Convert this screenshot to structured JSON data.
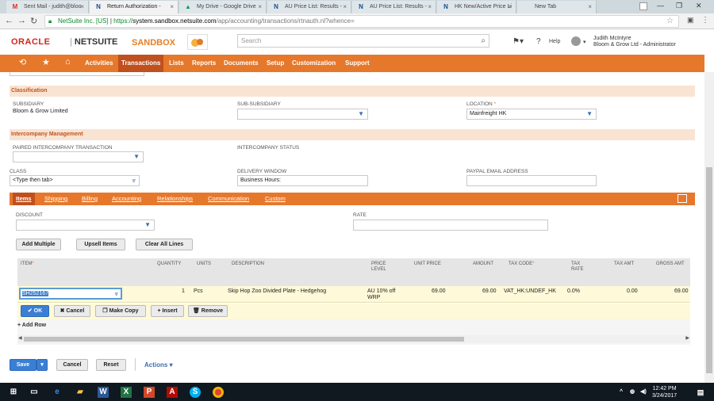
{
  "browser": {
    "tabs": [
      {
        "title": "Sent Mail - judith@bloo",
        "icon": "gmail-icon"
      },
      {
        "title": "Return Authorization -",
        "icon": "netsuite-icon",
        "active": true
      },
      {
        "title": "My Drive - Google Drive",
        "icon": "drive-icon"
      },
      {
        "title": "AU Price List: Results -",
        "icon": "netsuite-icon"
      },
      {
        "title": "AU Price List: Results -",
        "icon": "netsuite-icon"
      },
      {
        "title": "HK New/Active Price Li",
        "icon": "netsuite-icon"
      },
      {
        "title": "New Tab",
        "icon": ""
      }
    ],
    "address": {
      "secure_label": "NetSuite Inc. [US]",
      "protocol": "https://",
      "host": "system.sandbox.netsuite.com",
      "path": "/app/accounting/transactions/rtnauth.nl?whence="
    }
  },
  "header": {
    "brand_oracle": "ORACLE",
    "brand_netsuite": "NETSUITE",
    "sandbox_label": "SANDBOX",
    "search_placeholder": "Search",
    "help_label": "Help",
    "user_name": "Judith McIntyre",
    "user_role": "Bloom & Grow Ltd - Administrator"
  },
  "menu": {
    "items": [
      "Activities",
      "Transactions",
      "Lists",
      "Reports",
      "Documents",
      "Setup",
      "Customization",
      "Support"
    ],
    "active": "Transactions"
  },
  "classification": {
    "header": "Classification",
    "subsidiary_label": "SUBSIDIARY",
    "subsidiary_value": "Bloom & Grow Limited",
    "subsubsidiary_label": "SUB-SUBSIDIARY",
    "location_label": "LOCATION",
    "location_value": "Mainfreight HK"
  },
  "intercompany": {
    "header": "Intercompany Management",
    "paired_label": "PAIRED INTERCOMPANY TRANSACTION",
    "status_label": "INTERCOMPANY STATUS",
    "class_label": "CLASS",
    "class_value": "<Type then tab>",
    "delivery_label": "DELIVERY WINDOW",
    "delivery_value": "Business Hours:",
    "paypal_label": "PAYPAL EMAIL ADDRESS"
  },
  "subtabs": [
    "Items",
    "Shipping",
    "Billing",
    "Accounting",
    "Relationships",
    "Communication",
    "Custom"
  ],
  "items_tab": {
    "discount_label": "DISCOUNT",
    "rate_label": "RATE",
    "buttons": [
      "Add Multiple",
      "Upsell Items",
      "Clear All Lines"
    ],
    "columns": [
      "ITEM",
      "QUANTITY",
      "UNITS",
      "DESCRIPTION",
      "PRICE LEVEL",
      "UNIT PRICE",
      "AMOUNT",
      "TAX CODE",
      "TAX RATE",
      "TAX AMT",
      "GROSS AMT"
    ],
    "row": {
      "item": "SH252167",
      "quantity": "1",
      "units": "Pcs",
      "description": "Skip Hop Zoo Divided Plate - Hedgehog",
      "price_level": "AU 10% off WRP",
      "unit_price": "69.00",
      "amount": "69.00",
      "tax_code": "VAT_HK:UNDEF_HK",
      "tax_rate": "0.0%",
      "tax_amt": "0.00",
      "gross_amt": "69.00"
    },
    "row_actions": [
      "OK",
      "Cancel",
      "Make Copy",
      "Insert",
      "Remove"
    ],
    "add_row": "Add Row"
  },
  "footer_buttons": {
    "save": "Save",
    "cancel": "Cancel",
    "reset": "Reset",
    "actions": "Actions"
  },
  "taskbar": {
    "time": "12:42 PM",
    "date": "3/24/2017"
  },
  "colors": {
    "accent": "#e6782b",
    "accent_dark": "#c0501e",
    "section_bg": "#f9e3d3",
    "primary_button": "#3a7fd5"
  }
}
